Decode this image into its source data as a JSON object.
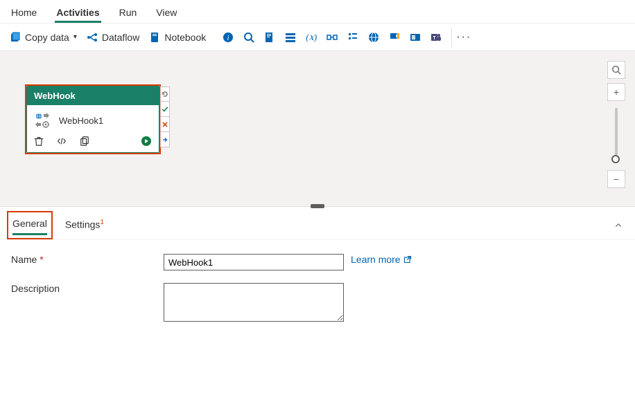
{
  "top_tabs": {
    "home": "Home",
    "activities": "Activities",
    "run": "Run",
    "view": "View"
  },
  "toolbar": {
    "copy_data": "Copy data",
    "dataflow": "Dataflow",
    "notebook": "Notebook"
  },
  "node": {
    "type_label": "WebHook",
    "name": "WebHook1"
  },
  "panel_tabs": {
    "general": "General",
    "settings": "Settings",
    "settings_badge": "1"
  },
  "form": {
    "name_label": "Name",
    "name_value": "WebHook1",
    "learn_more": "Learn more",
    "description_label": "Description",
    "description_value": ""
  }
}
